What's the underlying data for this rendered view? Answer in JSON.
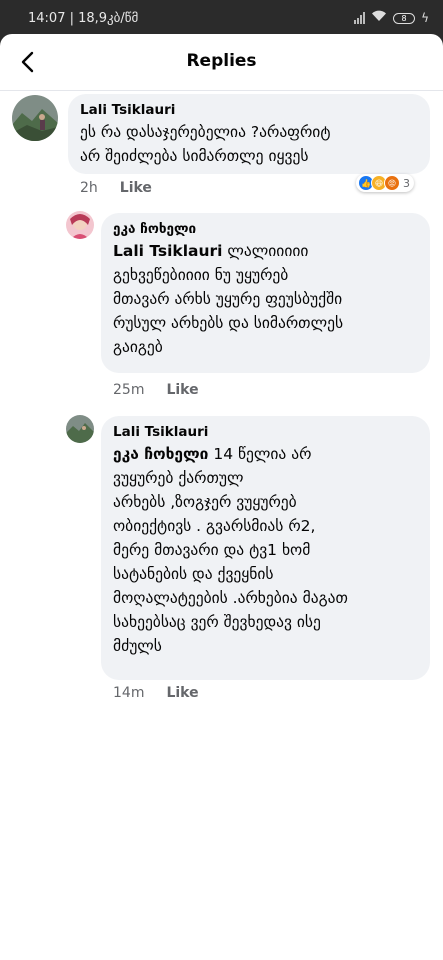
{
  "status_bar": {
    "time_info": "14:07 | 18,9კბ/წმ",
    "battery": "8"
  },
  "header": {
    "title": "Replies"
  },
  "comments": [
    {
      "author": "Lali Tsiklauri",
      "body_lines": [
        "ეს რა დასაჯერებელია ?არაფრიტ",
        "არ შეიძლება სიმართლე იყვეს"
      ],
      "time": "2h",
      "like_label": "Like",
      "reactions": {
        "icons": [
          "like",
          "haha",
          "angry"
        ],
        "count": "3"
      }
    },
    {
      "author": "ეკა ჩოხელი",
      "mention": "Lali Tsiklauri",
      "body_lines": [
        " ლალიიიიი",
        "გეხვეწებიიიი ნუ უყურებ",
        "მთავარ არხს უყურე ფეუსბუქში",
        "რუსულ არხებს და სიმართლეს",
        "გაიგებ"
      ],
      "time": "25m",
      "like_label": "Like"
    },
    {
      "author": "Lali Tsiklauri",
      "mention": "ეკა ჩოხელი",
      "body_lines": [
        " 14 წელია  არ",
        "ვუყურებ ქართულ",
        "არხებს ,ზოგჯერ ვუყურებ",
        "ობიექტივს  . გვარსმიას რ2,",
        "მერე მთავარი და ტვ1 ხომ",
        "სატანების და ქვეყნის",
        "მოღალატეების .არხებია მაგათ",
        "სახეებსაც ვერ შევხედავ ისე",
        "მძულს"
      ],
      "time": "14m",
      "like_label": "Like"
    }
  ]
}
